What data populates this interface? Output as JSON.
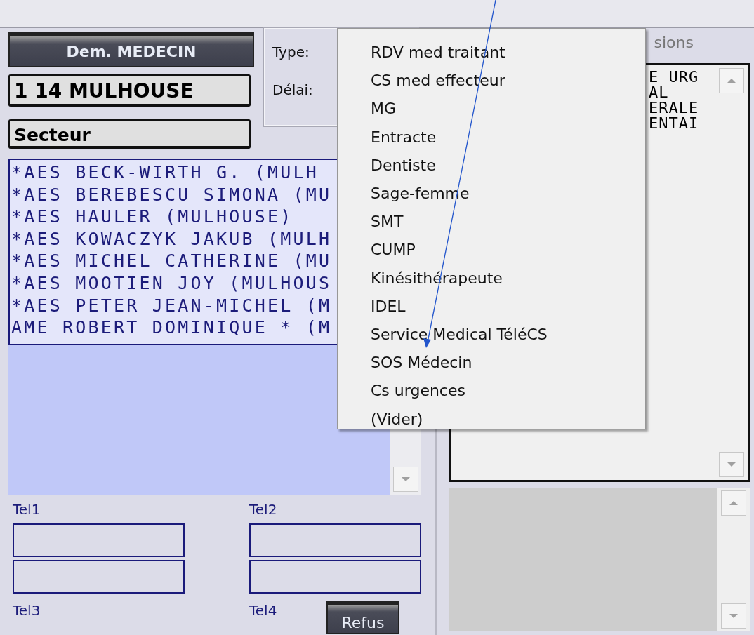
{
  "left": {
    "doctor_button": "Dem. MEDECIN",
    "location": "1 14 MULHOUSE",
    "sector": "Secteur",
    "type_label": "Type:",
    "delay_label": "Délai:",
    "doctors": [
      "*AES BECK-WIRTH G. (MULH",
      "*AES BEREBESCU SIMONA (MU",
      "*AES HAULER (MULHOUSE)",
      "*AES KOWACZYK JAKUB (MULH",
      "*AES MICHEL CATHERINE (MU",
      "*AES MOOTIEN JOY (MULHOUS",
      "*AES PETER JEAN-MICHEL (M",
      "AME ROBERT DOMINIQUE * (M"
    ],
    "phones": [
      {
        "label": "Tel1"
      },
      {
        "label": "Tel2"
      },
      {
        "label": "Tel3"
      },
      {
        "label": "Tel4"
      }
    ],
    "refuse_button": "Refus"
  },
  "right": {
    "header": "sions",
    "lines": [
      "E URG",
      "AL",
      "ERALE",
      "ENTAI"
    ]
  },
  "menu": [
    "RDV med traitant",
    "CS med effecteur",
    "MG",
    "Entracte",
    "Dentiste",
    "Sage-femme",
    "SMT",
    "CUMP",
    "Kinésithérapeute",
    "IDEL",
    "Service Medical TéléCS",
    "SOS Médecin",
    "Cs urgences",
    "(Vider)"
  ]
}
